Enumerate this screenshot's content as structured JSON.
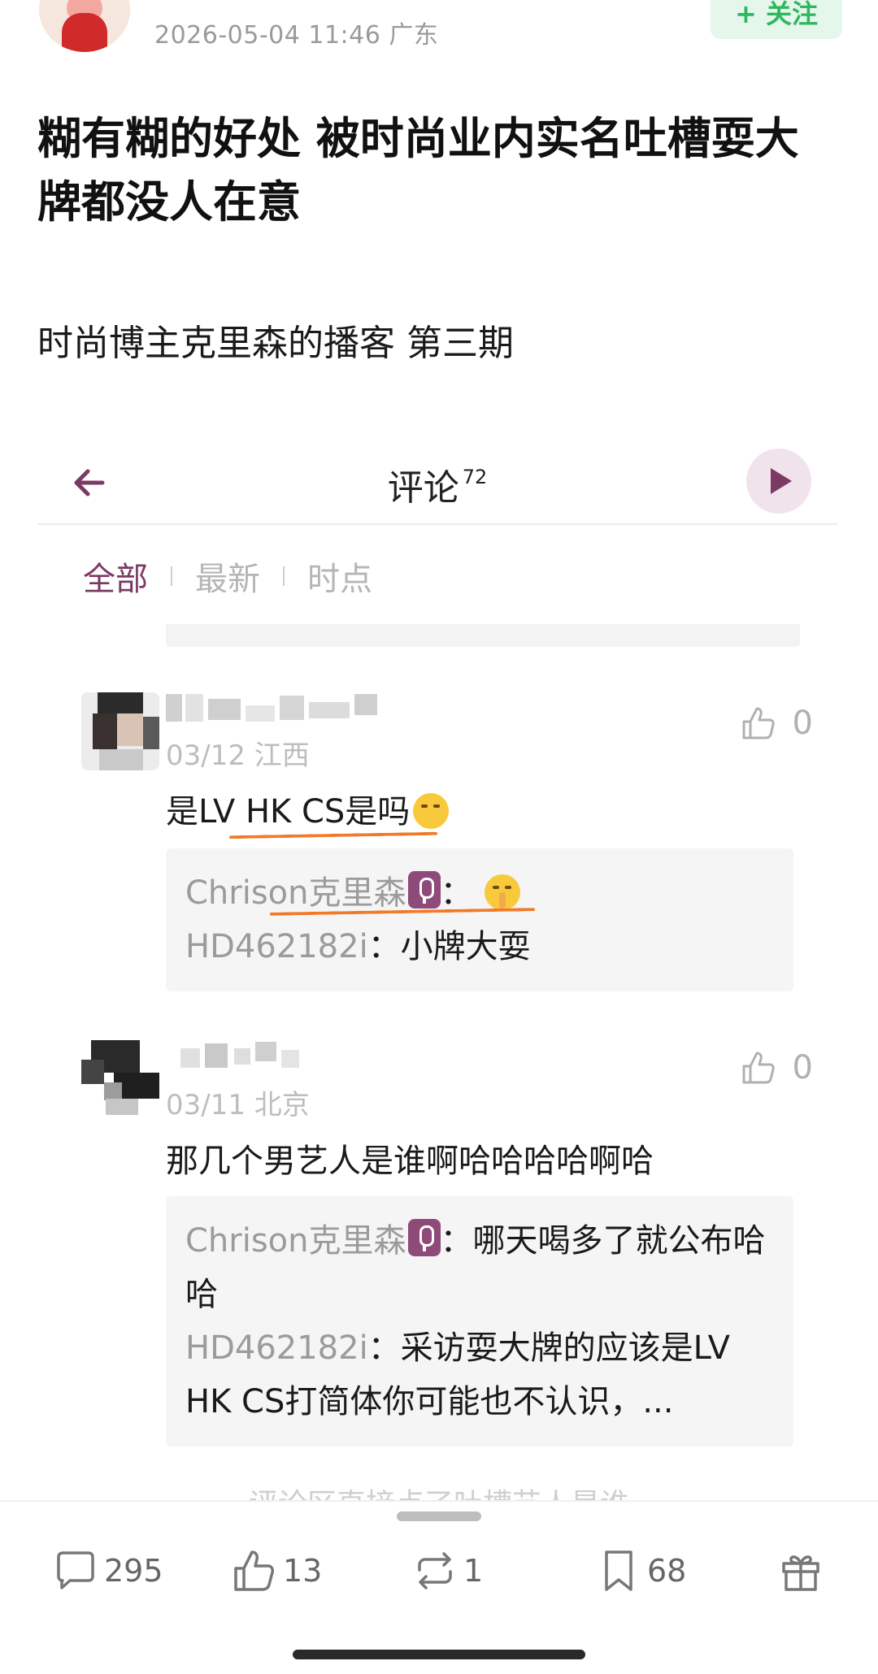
{
  "post": {
    "meta": "2026-05-04 11:46  广东",
    "follow_label": "+ 关注",
    "title": "糊有糊的好处 被时尚业内实名吐槽耍大牌都没人在意",
    "subtitle": "时尚博主克里森的播客 第三期"
  },
  "comments_panel": {
    "title": "评论",
    "count": "72",
    "tabs": [
      "全部",
      "最新",
      "时点"
    ]
  },
  "comments": [
    {
      "meta": "03/12 江西",
      "likes": "0",
      "text": "是LV HK CS是吗",
      "replies": [
        {
          "name": "Chrison克里森",
          "text": "："
        },
        {
          "name": "HD462182i",
          "text": "：小牌大耍"
        }
      ]
    },
    {
      "meta": "03/11 北京",
      "likes": "0",
      "text": "那几个男艺人是谁啊哈哈哈哈啊哈",
      "replies": [
        {
          "name": "Chrison克里森",
          "text": "：哪天喝多了就公布哈哈"
        },
        {
          "name": "HD462182i",
          "text": "：采访耍大牌的应该是LV HK CS打简体你可能也不认识，..."
        }
      ]
    }
  ],
  "peek_text": "评论区直接点了吐槽艺人是谁",
  "actions": {
    "comment_count": "295",
    "like_count": "13",
    "repost_count": "1",
    "bookmark_count": "68"
  },
  "colors": {
    "accent": "#7b3a63",
    "follow_green": "#2fb760",
    "highlight_orange": "#f07a2a"
  },
  "icons": [
    "back-arrow-icon",
    "play-icon",
    "thumbs-up-icon",
    "comment-icon",
    "repost-icon",
    "bookmark-icon",
    "gift-icon",
    "mic-icon"
  ]
}
